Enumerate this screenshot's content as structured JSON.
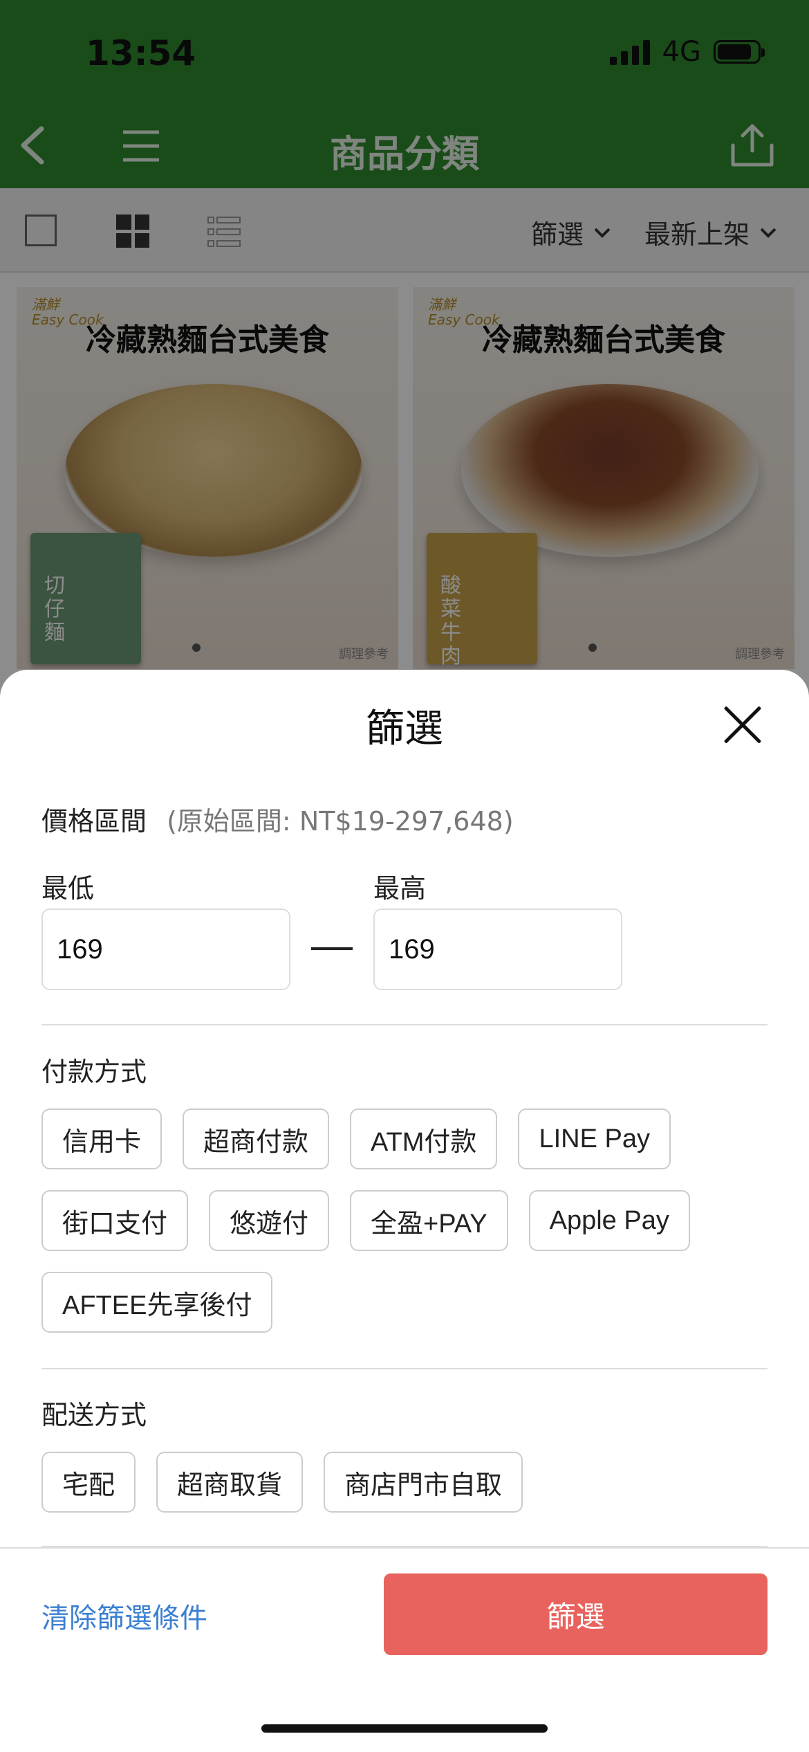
{
  "status_bar": {
    "time": "13:54",
    "network": "4G"
  },
  "header": {
    "title": "商品分類"
  },
  "toolbar": {
    "filter_label": "篩選",
    "sort_label": "最新上架"
  },
  "products": [
    {
      "brand": "滿鮮\nEasy Cook",
      "title": "冷藏熟麵台式美食",
      "pack_label": "切仔麵",
      "note": "調理參考"
    },
    {
      "brand": "滿鮮\nEasy Cook",
      "title": "冷藏熟麵台式美食",
      "pack_label": "酸菜牛肉",
      "note": "調理參考"
    }
  ],
  "filter_sheet": {
    "title": "篩選",
    "price": {
      "label": "價格區間",
      "range_note": "(原始區間: NT$19-297,648)",
      "min_label": "最低",
      "max_label": "最高",
      "min_value": "169",
      "max_value": "169"
    },
    "payment": {
      "label": "付款方式",
      "options": [
        "信用卡",
        "超商付款",
        "ATM付款",
        "LINE Pay",
        "街口支付",
        "悠遊付",
        "全盈+PAY",
        "Apple Pay",
        "AFTEE先享後付"
      ]
    },
    "shipping": {
      "label": "配送方式",
      "options": [
        "宅配",
        "超商取貨",
        "商店門市自取"
      ]
    },
    "clear_label": "清除篩選條件",
    "submit_label": "篩選"
  },
  "colors": {
    "header_green": "#2e8b2e",
    "submit_red": "#e8635e",
    "link_blue": "#3b7fd1"
  }
}
